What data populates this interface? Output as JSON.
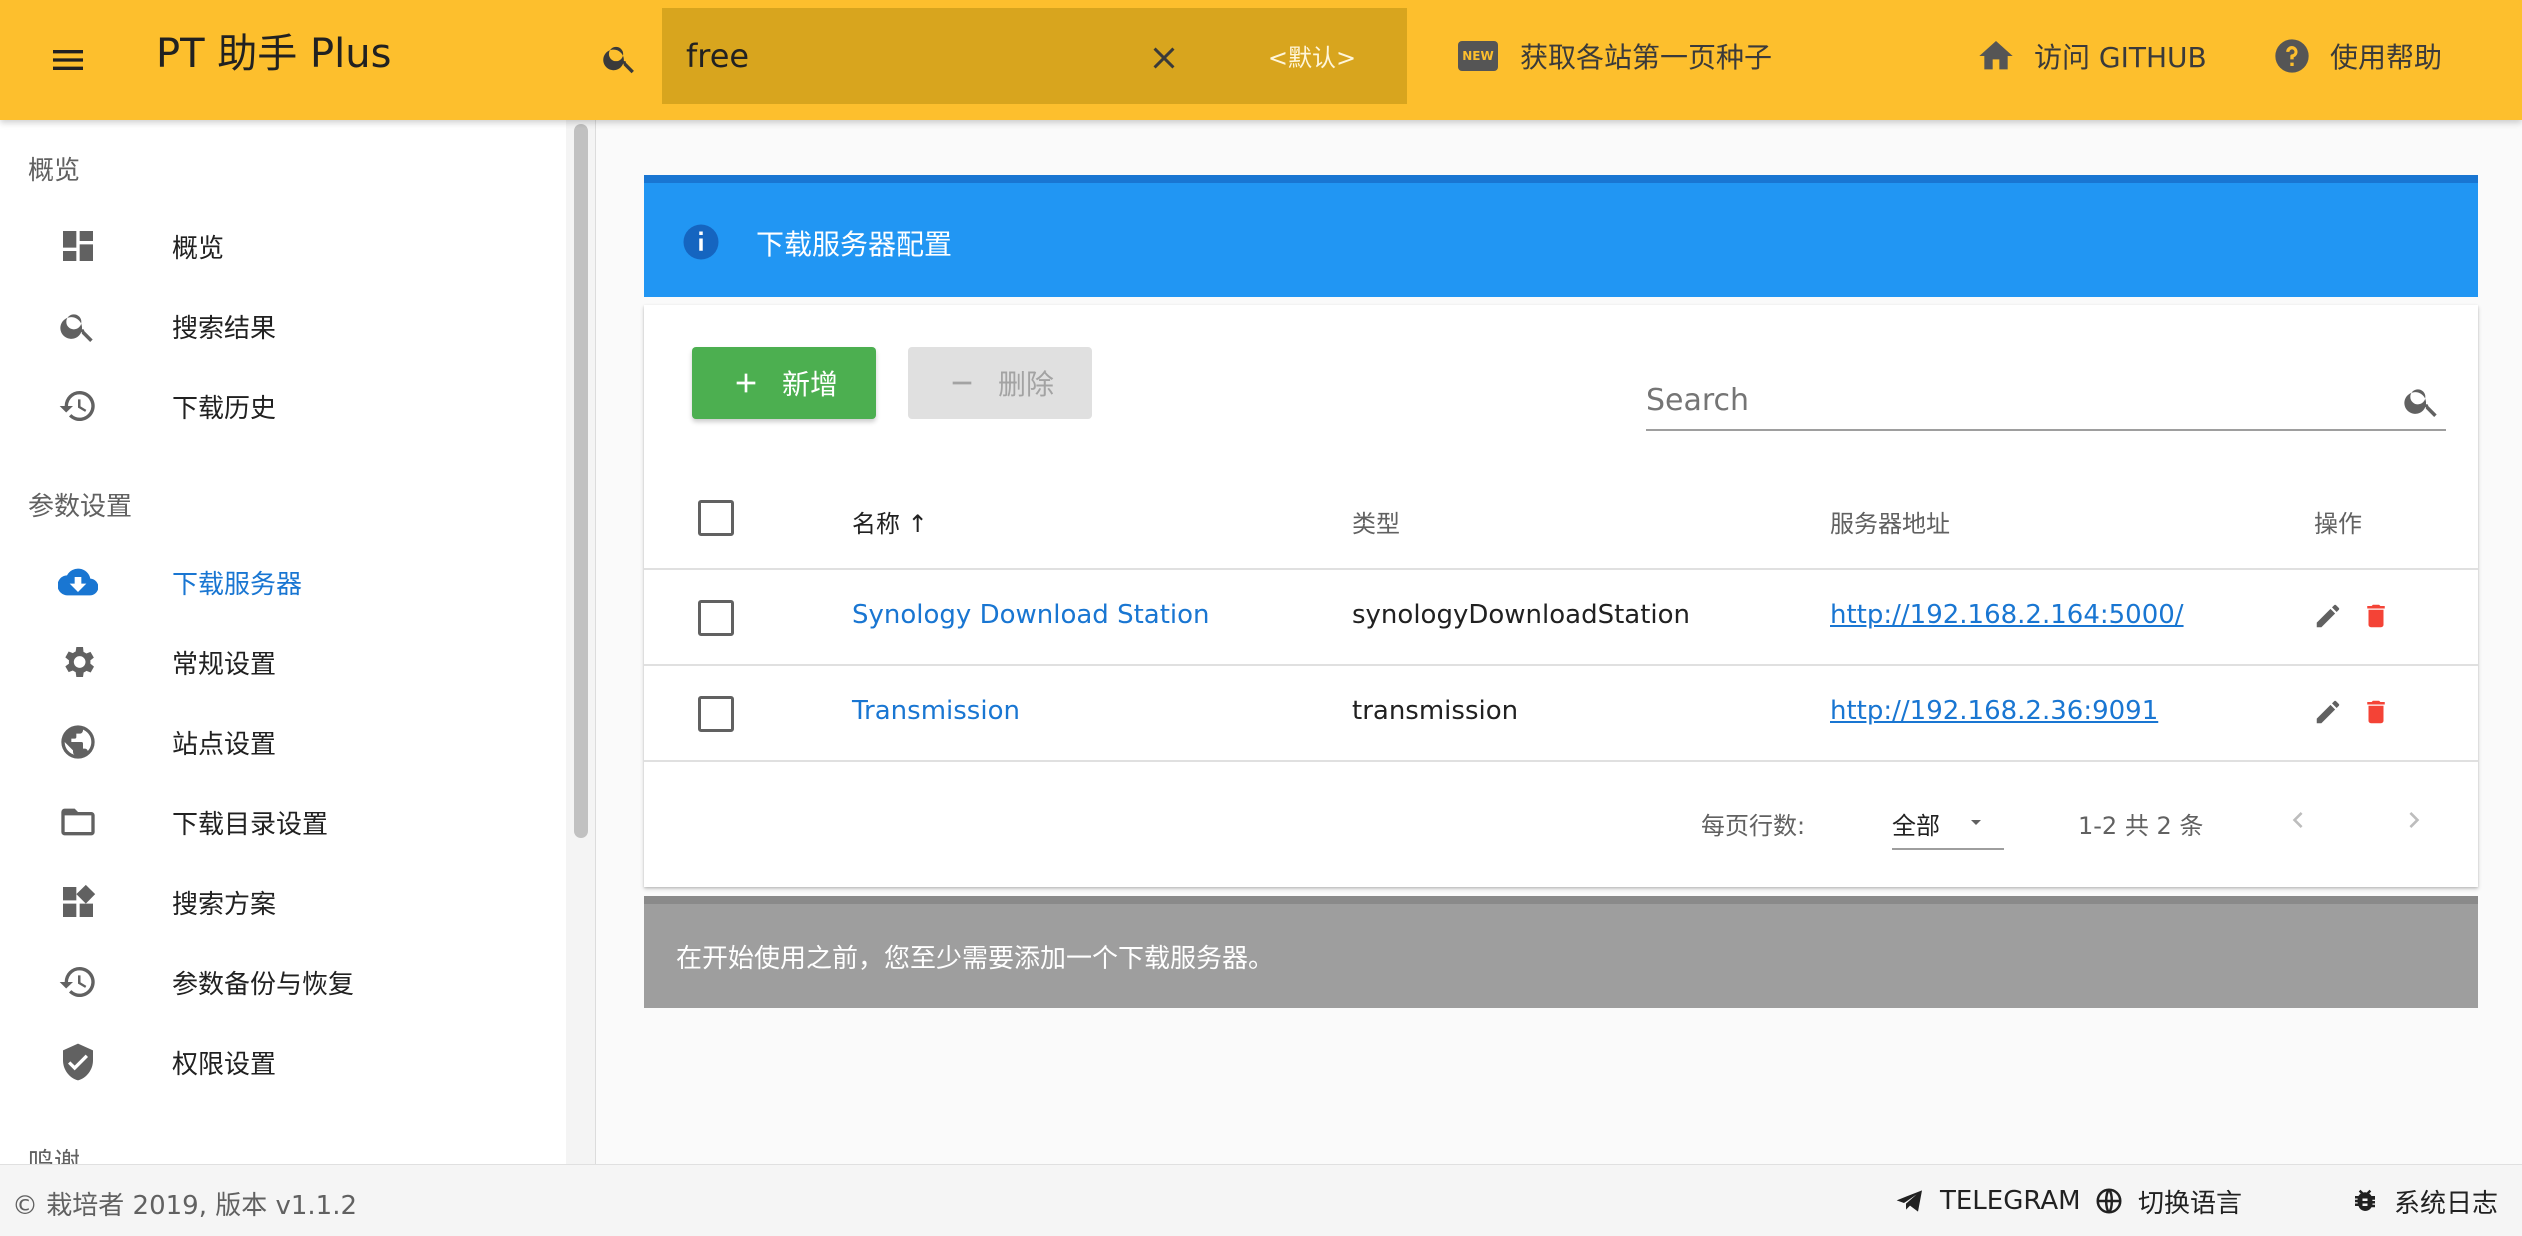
{
  "header": {
    "title": "PT 助手 Plus",
    "search": {
      "value": "free",
      "placeholder": ""
    },
    "scheme_label": "<默认>",
    "actions": {
      "fetch_first_page": "获取各站第一页种子",
      "visit_github": "访问 GITHUB",
      "help": "使用帮助"
    },
    "new_badge": "NEW"
  },
  "sidebar": {
    "section_overview": "概览",
    "section_settings": "参数设置",
    "section_thanks": "鸣谢",
    "items": [
      {
        "label": "概览",
        "icon": "dashboard-icon"
      },
      {
        "label": "搜索结果",
        "icon": "search-icon"
      },
      {
        "label": "下载历史",
        "icon": "history-icon"
      },
      {
        "label": "下载服务器",
        "icon": "cloud-download-icon",
        "active": true
      },
      {
        "label": "常规设置",
        "icon": "gear-icon"
      },
      {
        "label": "站点设置",
        "icon": "globe-icon"
      },
      {
        "label": "下载目录设置",
        "icon": "folder-icon"
      },
      {
        "label": "搜索方案",
        "icon": "widgets-icon"
      },
      {
        "label": "参数备份与恢复",
        "icon": "restore-icon"
      },
      {
        "label": "权限设置",
        "icon": "shield-check-icon"
      }
    ]
  },
  "main": {
    "banner_text": "下载服务器配置",
    "add_label": "新增",
    "delete_label": "删除",
    "table_search_placeholder": "Search",
    "columns": {
      "name": "名称 ↑",
      "type": "类型",
      "address": "服务器地址",
      "actions": "操作"
    },
    "rows": [
      {
        "name": "Synology Download Station",
        "type": "synologyDownloadStation",
        "address": "http://192.168.2.164:5000/"
      },
      {
        "name": "Transmission",
        "type": "transmission",
        "address": "http://192.168.2.36:9091"
      }
    ],
    "pager": {
      "rows_per_page_label": "每页行数:",
      "rows_per_page_value": "全部",
      "range": "1-2 共 2 条"
    },
    "note": "在开始使用之前，您至少需要添加一个下载服务器。"
  },
  "footer": {
    "copyright": "© 栽培者 2019, 版本 v1.1.2",
    "telegram": "TELEGRAM",
    "language": "切换语言",
    "log": "系统日志"
  },
  "colors": {
    "appbar": "#fdbf2d",
    "search_box": "#d8a51e",
    "primary": "#2196f3",
    "active": "#1976d2",
    "success": "#4caf50",
    "danger": "#f44336",
    "note": "#9e9e9e"
  }
}
